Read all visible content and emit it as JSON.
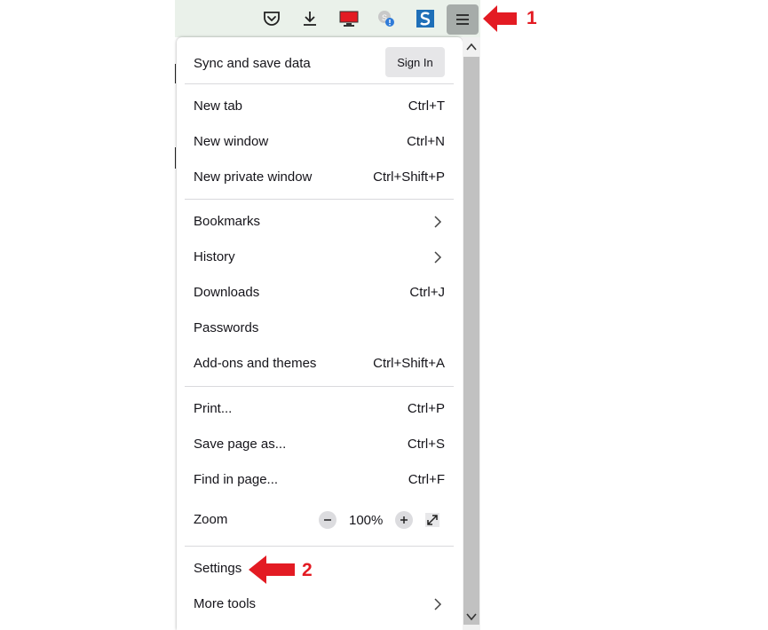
{
  "toolbar": {
    "icons": [
      "pocket-icon",
      "download-icon",
      "monitor-icon",
      "extension-badge-icon",
      "s-app-icon",
      "hamburger-menu-icon"
    ]
  },
  "menu": {
    "sync": {
      "title": "Sync and save data",
      "button": "Sign In"
    },
    "groups": [
      [
        {
          "label": "New tab",
          "shortcut": "Ctrl+T"
        },
        {
          "label": "New window",
          "shortcut": "Ctrl+N"
        },
        {
          "label": "New private window",
          "shortcut": "Ctrl+Shift+P"
        }
      ],
      [
        {
          "label": "Bookmarks",
          "submenu": true
        },
        {
          "label": "History",
          "submenu": true
        },
        {
          "label": "Downloads",
          "shortcut": "Ctrl+J"
        },
        {
          "label": "Passwords"
        },
        {
          "label": "Add-ons and themes",
          "shortcut": "Ctrl+Shift+A"
        }
      ],
      [
        {
          "label": "Print...",
          "shortcut": "Ctrl+P"
        },
        {
          "label": "Save page as...",
          "shortcut": "Ctrl+S"
        },
        {
          "label": "Find in page...",
          "shortcut": "Ctrl+F"
        }
      ]
    ],
    "zoom": {
      "label": "Zoom",
      "value": "100%"
    },
    "settings": {
      "label": "Settings"
    },
    "more_tools": {
      "label": "More tools"
    }
  },
  "callouts": {
    "one": "1",
    "two": "2"
  },
  "colors": {
    "callout_red": "#e31b23",
    "toolbar_bg": "#eaf1ea",
    "menu_btn_active": "#a6aca9"
  }
}
